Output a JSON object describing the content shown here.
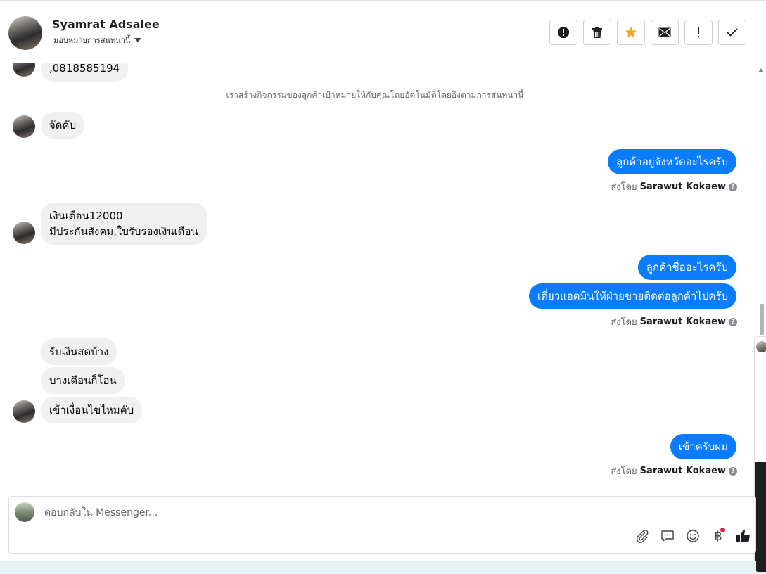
{
  "header": {
    "contact_name": "Syamrat Adsalee",
    "assign_label": "มอบหมายการสนทนานี้",
    "actions": [
      {
        "name": "spam-icon",
        "glyph": "!"
      },
      {
        "name": "trash-icon"
      },
      {
        "name": "star-icon",
        "color": "#f5a623"
      },
      {
        "name": "mail-icon"
      },
      {
        "name": "follow-up-icon",
        "glyph": "!"
      },
      {
        "name": "done-icon"
      }
    ]
  },
  "thread": {
    "partial_message": ",0818585194",
    "system_note": "เราสร้างกิจกรรมของลูกค้าเป้าหมายให้กับคุณโดยอัตโนมัติโดยอิงตามการสนทนานี้",
    "messages": [
      {
        "direction": "in",
        "text": "จัดคับ"
      },
      {
        "direction": "out",
        "text": "ลูกค้าอยู่จังหวัดอะไรครับ"
      },
      {
        "direction": "in",
        "text_line1": "เงินเดือน12000",
        "text_line2": "มีประกันสังคม,ใบรับรองเงินเดือน"
      },
      {
        "direction": "out",
        "text": "ลูกค้าชื่ออะไรครับ"
      },
      {
        "direction": "out",
        "text": "เดี่ยวแอดมินให้ฝ่ายขายติดต่อลูกค้าไปครับ"
      },
      {
        "direction": "in",
        "text": "รับเงินสดบ้าง"
      },
      {
        "direction": "in",
        "text": "บางเดือนก็โอน"
      },
      {
        "direction": "in",
        "text": "เข้าเงื่อนไขไหมคับ"
      },
      {
        "direction": "out",
        "text": "เข้าครับผม"
      }
    ],
    "sent_by_prefix": "ส่งโดย",
    "sent_by_name": "Sarawut Kokaew",
    "outgoing_color": "#0a7cff"
  },
  "composer": {
    "placeholder": "ตอบกลับใน Messenger...",
    "currency_glyph": "฿",
    "tools": [
      "attach-icon",
      "saved-reply-icon",
      "emoji-icon",
      "payment-icon",
      "like-icon"
    ]
  }
}
